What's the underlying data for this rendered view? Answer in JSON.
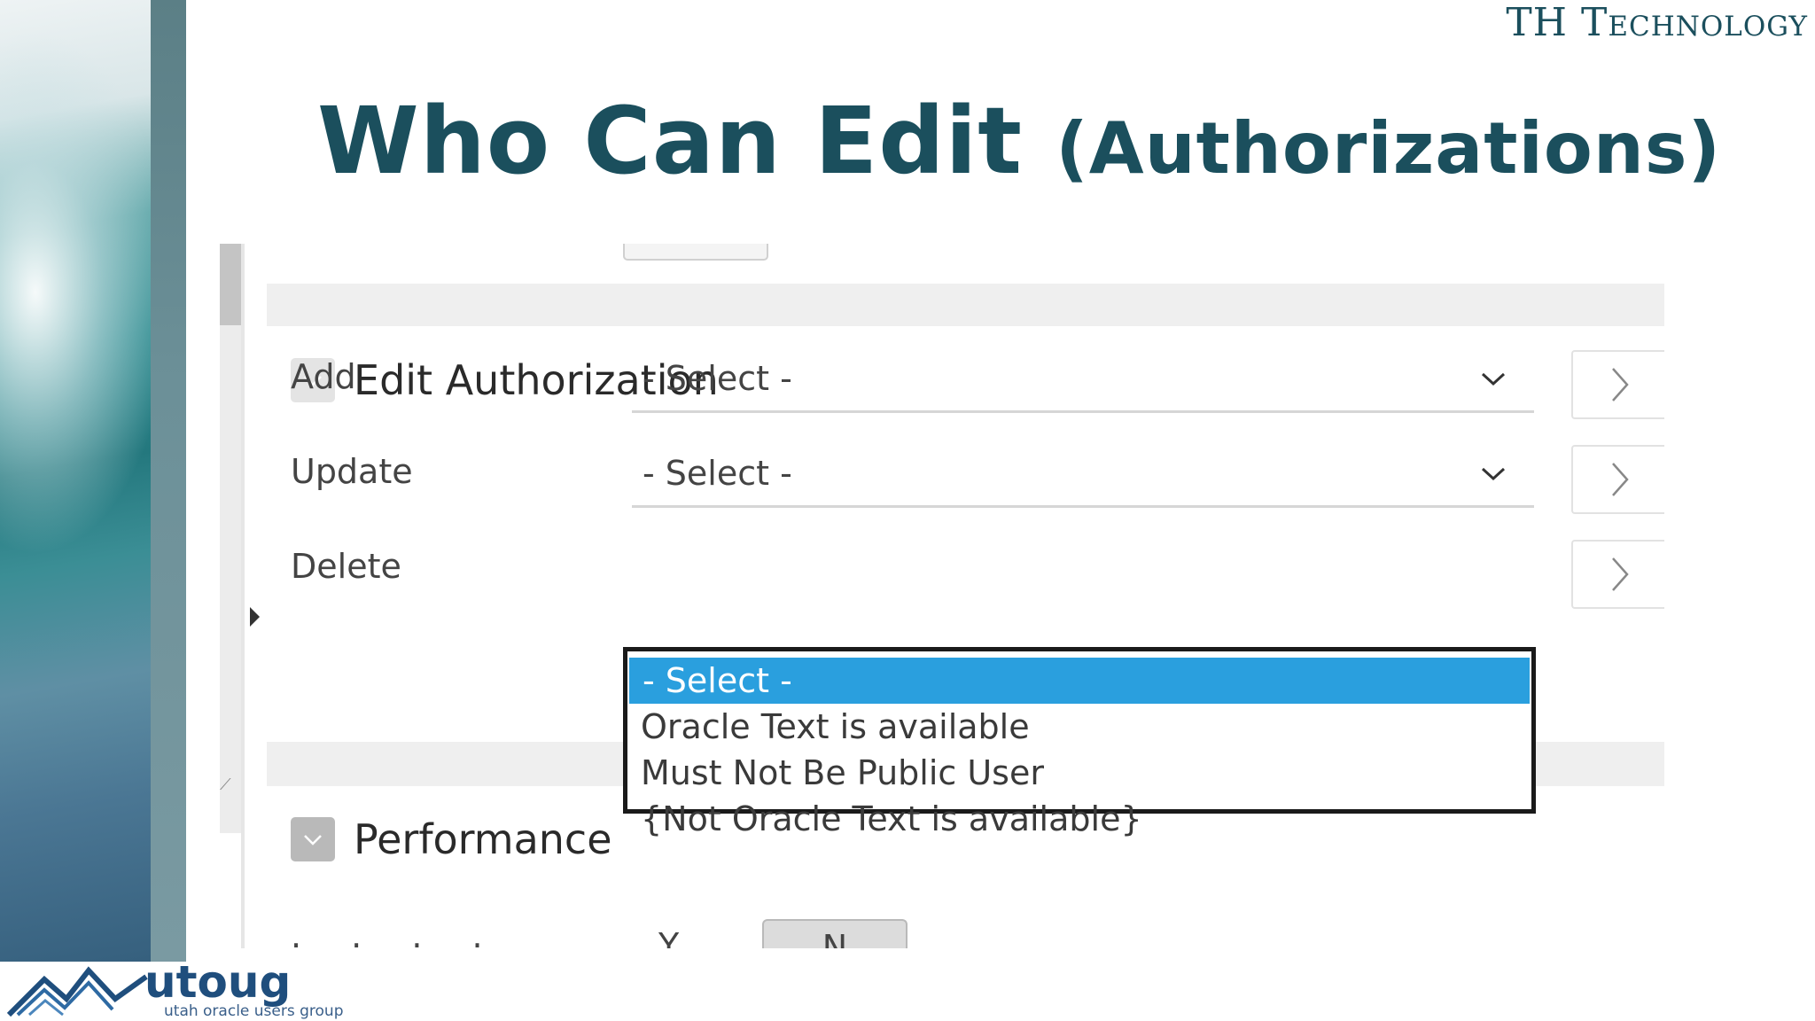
{
  "slide": {
    "brand": "TH Technology",
    "title_main": "Who Can Edit",
    "title_sub": "(Authorizations)"
  },
  "edit_region": {
    "title": "Edit Authorization"
  },
  "fields": [
    {
      "label": "Add",
      "value": "- Select -"
    },
    {
      "label": "Update",
      "value": "- Select -"
    },
    {
      "label": "Delete"
    }
  ],
  "dropdown": {
    "options": [
      "- Select -",
      "Oracle Text is available",
      "Must Not Be Public User",
      "{Not Oracle Text is available}"
    ],
    "selected_index": 0
  },
  "performance_region": {
    "title": "Performance"
  },
  "colors": {
    "title": "#1b4f5d",
    "selected_option": "#2a9fde",
    "dropdown_border": "#1a1a1a"
  },
  "logo": {
    "word": "utoug",
    "tagline": "utah oracle users group"
  }
}
